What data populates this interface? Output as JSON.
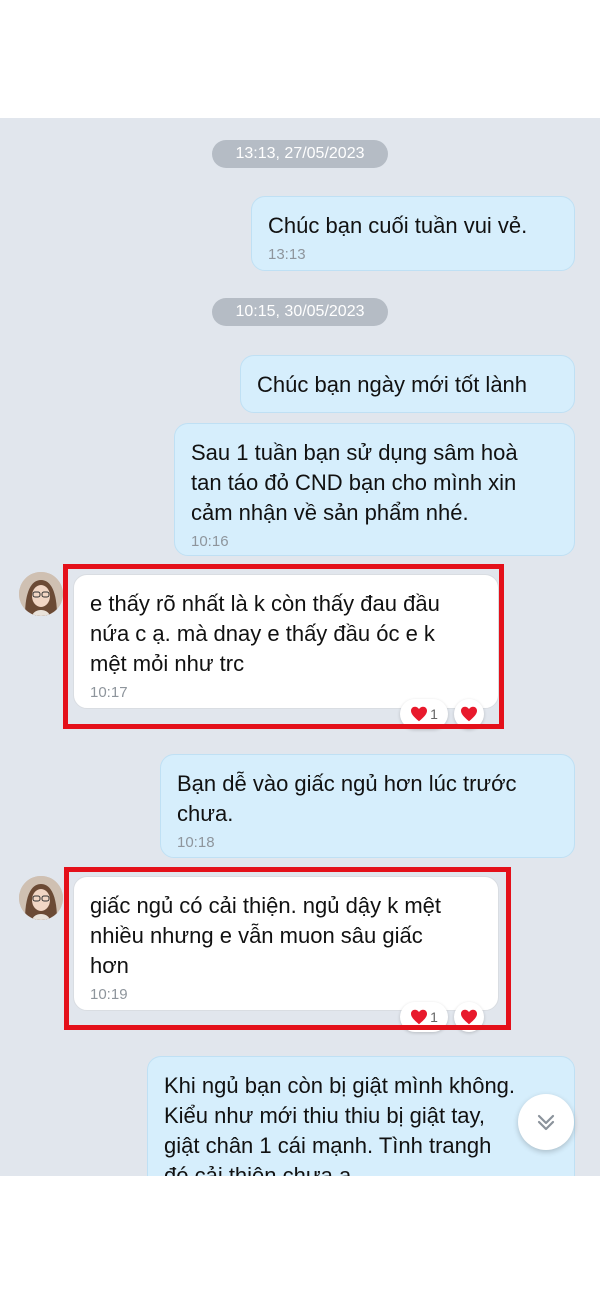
{
  "messages": [
    {
      "kind": "separator",
      "text": "13:13, 27/05/2023"
    },
    {
      "kind": "sent",
      "text": "Chúc bạn cuối tuần vui vẻ.",
      "time": "13:13"
    },
    {
      "kind": "separator",
      "text": "10:15, 30/05/2023"
    },
    {
      "kind": "sent",
      "text": "Chúc bạn ngày mới tốt lành"
    },
    {
      "kind": "sent",
      "text": "Sau 1 tuần bạn sử dụng sâm hoà\ntan táo đỏ CND bạn cho mình xin\ncảm nhận về sản phẩm nhé.",
      "time": "10:16"
    },
    {
      "kind": "received",
      "text": "e thấy rõ nhất là k còn thấy đau đầu\nnứa c ạ. mà dnay e thấy đầu óc e k\nmệt mỏi như trc",
      "time": "10:17",
      "reaction_count": "1"
    },
    {
      "kind": "sent",
      "text": "Bạn dễ vào giấc ngủ hơn lúc trước\nchưa.",
      "time": "10:18"
    },
    {
      "kind": "received",
      "text": "giấc ngủ có cải thiện. ngủ dậy k mệt\nnhiều nhưng e vẫn muon sâu giấc\nhơn",
      "time": "10:19",
      "reaction_count": "1"
    },
    {
      "kind": "sent",
      "text": "Khi ngủ bạn còn bị giật mình không.\nKiểu như mới thiu thiu bị giật tay,\ngiật chân 1 cái mạnh. Tình trangh\nđó cải thiện chưa ạ"
    }
  ],
  "icons": {
    "reaction": "heart-icon",
    "scroll": "chevron-down-double-icon"
  },
  "colors": {
    "sent_bubble": "#d6eefc",
    "received_bubble": "#ffffff",
    "chat_background": "#e1e6ed",
    "highlight": "#e4101a",
    "heart": "#e8192c"
  }
}
